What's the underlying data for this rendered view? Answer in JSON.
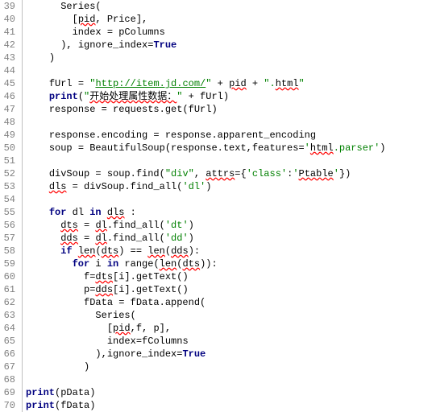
{
  "lines": [
    {
      "num": 39,
      "indent": "      ",
      "segs": [
        {
          "c": "",
          "t": "Series("
        }
      ]
    },
    {
      "num": 40,
      "indent": "        ",
      "segs": [
        {
          "c": "",
          "t": "["
        },
        {
          "c": "err",
          "t": "pid"
        },
        {
          "c": "",
          "t": ", Price],"
        }
      ]
    },
    {
      "num": 41,
      "indent": "        ",
      "segs": [
        {
          "c": "",
          "t": "index = pColumns"
        }
      ]
    },
    {
      "num": 42,
      "indent": "      ",
      "segs": [
        {
          "c": "",
          "t": "), ignore_index="
        },
        {
          "c": "kw",
          "t": "True"
        }
      ]
    },
    {
      "num": 43,
      "indent": "    ",
      "segs": [
        {
          "c": "",
          "t": ")"
        }
      ]
    },
    {
      "num": 44,
      "indent": "",
      "segs": []
    },
    {
      "num": 45,
      "indent": "    ",
      "segs": [
        {
          "c": "",
          "t": "fUrl = "
        },
        {
          "c": "str",
          "t": "\""
        },
        {
          "c": "url",
          "t": "http://item.jd.com/"
        },
        {
          "c": "str",
          "t": "\""
        },
        {
          "c": "",
          "t": " + "
        },
        {
          "c": "err",
          "t": "pid"
        },
        {
          "c": "",
          "t": " + "
        },
        {
          "c": "str",
          "t": "\"."
        },
        {
          "c": "err",
          "t": "html"
        },
        {
          "c": "str",
          "t": "\""
        }
      ]
    },
    {
      "num": 46,
      "indent": "    ",
      "segs": [
        {
          "c": "kw",
          "t": "print"
        },
        {
          "c": "",
          "t": "("
        },
        {
          "c": "str",
          "t": "\""
        },
        {
          "c": "err",
          "t": "开始处理属性数据："
        },
        {
          "c": "str",
          "t": "\""
        },
        {
          "c": "",
          "t": " + fUrl)"
        }
      ]
    },
    {
      "num": 47,
      "indent": "    ",
      "segs": [
        {
          "c": "",
          "t": "response = requests.get(fUrl)"
        }
      ]
    },
    {
      "num": 48,
      "indent": "",
      "segs": []
    },
    {
      "num": 49,
      "indent": "    ",
      "segs": [
        {
          "c": "",
          "t": "response.encoding = response.apparent_encoding"
        }
      ]
    },
    {
      "num": 50,
      "indent": "    ",
      "segs": [
        {
          "c": "",
          "t": "soup = BeautifulSoup(response.text,features="
        },
        {
          "c": "str",
          "t": "'"
        },
        {
          "c": "err",
          "t": "html"
        },
        {
          "c": "str",
          "t": ".parser'"
        },
        {
          "c": "",
          "t": ")"
        }
      ]
    },
    {
      "num": 51,
      "indent": "",
      "segs": []
    },
    {
      "num": 52,
      "indent": "    ",
      "segs": [
        {
          "c": "",
          "t": "divSoup = soup.find("
        },
        {
          "c": "str",
          "t": "\"div\""
        },
        {
          "c": "",
          "t": ", "
        },
        {
          "c": "err",
          "t": "attrs"
        },
        {
          "c": "",
          "t": "={"
        },
        {
          "c": "str",
          "t": "'class'"
        },
        {
          "c": "",
          "t": ":"
        },
        {
          "c": "str",
          "t": "'"
        },
        {
          "c": "err",
          "t": "Ptable"
        },
        {
          "c": "str",
          "t": "'"
        },
        {
          "c": "",
          "t": "})"
        }
      ]
    },
    {
      "num": 53,
      "indent": "    ",
      "segs": [
        {
          "c": "err",
          "t": "dls"
        },
        {
          "c": "",
          "t": " = divSoup.find_all("
        },
        {
          "c": "str",
          "t": "'dl'"
        },
        {
          "c": "",
          "t": ")"
        }
      ]
    },
    {
      "num": 54,
      "indent": "",
      "segs": []
    },
    {
      "num": 55,
      "indent": "    ",
      "segs": [
        {
          "c": "kw",
          "t": "for"
        },
        {
          "c": "",
          "t": " dl "
        },
        {
          "c": "kw",
          "t": "in"
        },
        {
          "c": "",
          "t": " "
        },
        {
          "c": "err",
          "t": "dls"
        },
        {
          "c": "",
          "t": " :"
        }
      ]
    },
    {
      "num": 56,
      "indent": "      ",
      "segs": [
        {
          "c": "err",
          "t": "dts"
        },
        {
          "c": "",
          "t": " = "
        },
        {
          "c": "err",
          "t": "dl"
        },
        {
          "c": "",
          "t": ".find_all("
        },
        {
          "c": "str",
          "t": "'dt'"
        },
        {
          "c": "",
          "t": ")"
        }
      ]
    },
    {
      "num": 57,
      "indent": "      ",
      "segs": [
        {
          "c": "err",
          "t": "dds"
        },
        {
          "c": "",
          "t": " = "
        },
        {
          "c": "err",
          "t": "dl"
        },
        {
          "c": "",
          "t": ".find_all("
        },
        {
          "c": "str",
          "t": "'dd'"
        },
        {
          "c": "",
          "t": ")"
        }
      ]
    },
    {
      "num": 58,
      "indent": "      ",
      "segs": [
        {
          "c": "kw",
          "t": "if"
        },
        {
          "c": "",
          "t": " "
        },
        {
          "c": "err",
          "t": "len"
        },
        {
          "c": "",
          "t": "("
        },
        {
          "c": "err",
          "t": "dts"
        },
        {
          "c": "",
          "t": ") == "
        },
        {
          "c": "err",
          "t": "len"
        },
        {
          "c": "",
          "t": "("
        },
        {
          "c": "err",
          "t": "dds"
        },
        {
          "c": "",
          "t": "):"
        }
      ]
    },
    {
      "num": 59,
      "indent": "        ",
      "segs": [
        {
          "c": "kw",
          "t": "for"
        },
        {
          "c": "",
          "t": " i "
        },
        {
          "c": "kw",
          "t": "in"
        },
        {
          "c": "",
          "t": " range("
        },
        {
          "c": "err",
          "t": "len"
        },
        {
          "c": "",
          "t": "("
        },
        {
          "c": "err",
          "t": "dts"
        },
        {
          "c": "",
          "t": ")):"
        }
      ]
    },
    {
      "num": 60,
      "indent": "          ",
      "segs": [
        {
          "c": "",
          "t": "f="
        },
        {
          "c": "err",
          "t": "dts"
        },
        {
          "c": "",
          "t": "[i].getText()"
        }
      ]
    },
    {
      "num": 61,
      "indent": "          ",
      "segs": [
        {
          "c": "",
          "t": "p="
        },
        {
          "c": "err",
          "t": "dds"
        },
        {
          "c": "",
          "t": "[i].getText()"
        }
      ]
    },
    {
      "num": 62,
      "indent": "          ",
      "segs": [
        {
          "c": "",
          "t": "fData = fData.append("
        }
      ]
    },
    {
      "num": 63,
      "indent": "            ",
      "segs": [
        {
          "c": "",
          "t": "Series("
        }
      ]
    },
    {
      "num": 64,
      "indent": "              ",
      "segs": [
        {
          "c": "",
          "t": "["
        },
        {
          "c": "err",
          "t": "pid"
        },
        {
          "c": "",
          "t": ",f, p],"
        }
      ]
    },
    {
      "num": 65,
      "indent": "              ",
      "segs": [
        {
          "c": "",
          "t": "index=fColumns"
        }
      ]
    },
    {
      "num": 66,
      "indent": "            ",
      "segs": [
        {
          "c": "",
          "t": "),ignore_index="
        },
        {
          "c": "kw",
          "t": "True"
        }
      ]
    },
    {
      "num": 67,
      "indent": "          ",
      "segs": [
        {
          "c": "",
          "t": ")"
        }
      ]
    },
    {
      "num": 68,
      "indent": "",
      "segs": []
    },
    {
      "num": 69,
      "indent": "",
      "segs": [
        {
          "c": "kw",
          "t": "print"
        },
        {
          "c": "",
          "t": "(pData)"
        }
      ]
    },
    {
      "num": 70,
      "indent": "",
      "segs": [
        {
          "c": "kw",
          "t": "print"
        },
        {
          "c": "",
          "t": "(fData)"
        }
      ]
    }
  ]
}
